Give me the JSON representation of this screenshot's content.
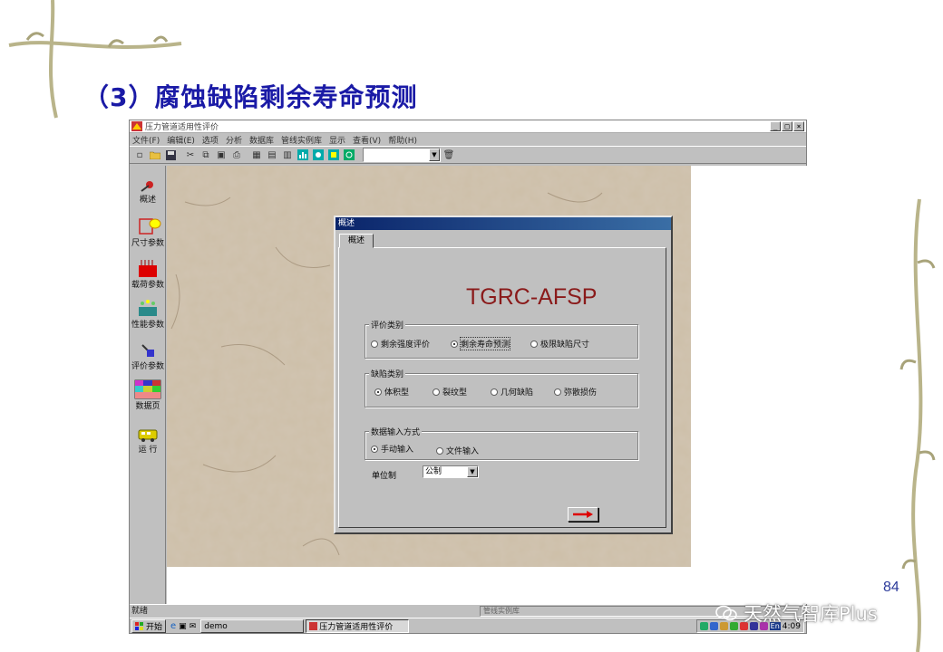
{
  "slide": {
    "title": "（3）腐蚀缺陷剩余寿命预测",
    "page_number": "84",
    "watermark": "天然气智库Plus"
  },
  "window": {
    "title": "压力管道适用性评价",
    "controls": [
      "_",
      "□",
      "×"
    ],
    "menu": [
      "文件(F)",
      "编辑(E)",
      "选项",
      "分析",
      "数据库",
      "管线实例库",
      "显示",
      "查看(V)",
      "帮助(H)"
    ]
  },
  "sidebar": {
    "items": [
      {
        "label": "概述",
        "icon": "gear-icon"
      },
      {
        "label": "尺寸参数",
        "icon": "ruler-icon"
      },
      {
        "label": "载荷参数",
        "icon": "load-icon"
      },
      {
        "label": "性能参数",
        "icon": "performance-icon"
      },
      {
        "label": "评价参数",
        "icon": "evaluate-icon"
      },
      {
        "label": "数据页",
        "icon": "grid-icon"
      },
      {
        "label": "运  行",
        "icon": "bus-icon"
      }
    ]
  },
  "dialog": {
    "title": "概述",
    "tab": "概述",
    "logo": "TGRC-AFSP",
    "eval_group": {
      "label": "评价类别",
      "options": [
        "剩余强度评价",
        "剩余寿命预测",
        "极限缺陷尺寸"
      ],
      "selected": 1
    },
    "defect_group": {
      "label": "缺陷类别",
      "options": [
        "体积型",
        "裂纹型",
        "几何缺陷",
        "弥散损伤"
      ],
      "selected": 0
    },
    "input_group": {
      "label": "数据输入方式",
      "options": [
        "手动输入",
        "文件输入"
      ],
      "selected": 0
    },
    "unit": {
      "label": "单位制",
      "value": "公制"
    }
  },
  "status": {
    "left": "就绪",
    "panel": "管线实例库"
  },
  "taskbar": {
    "start": "开始",
    "tasks": [
      "demo",
      "压力管道适用性评价"
    ],
    "clock": "4:09",
    "lang": "En"
  },
  "colors": {
    "title": "#1a1aa6",
    "logo": "#8a1a1a",
    "dialog_title": "#0a246a"
  }
}
